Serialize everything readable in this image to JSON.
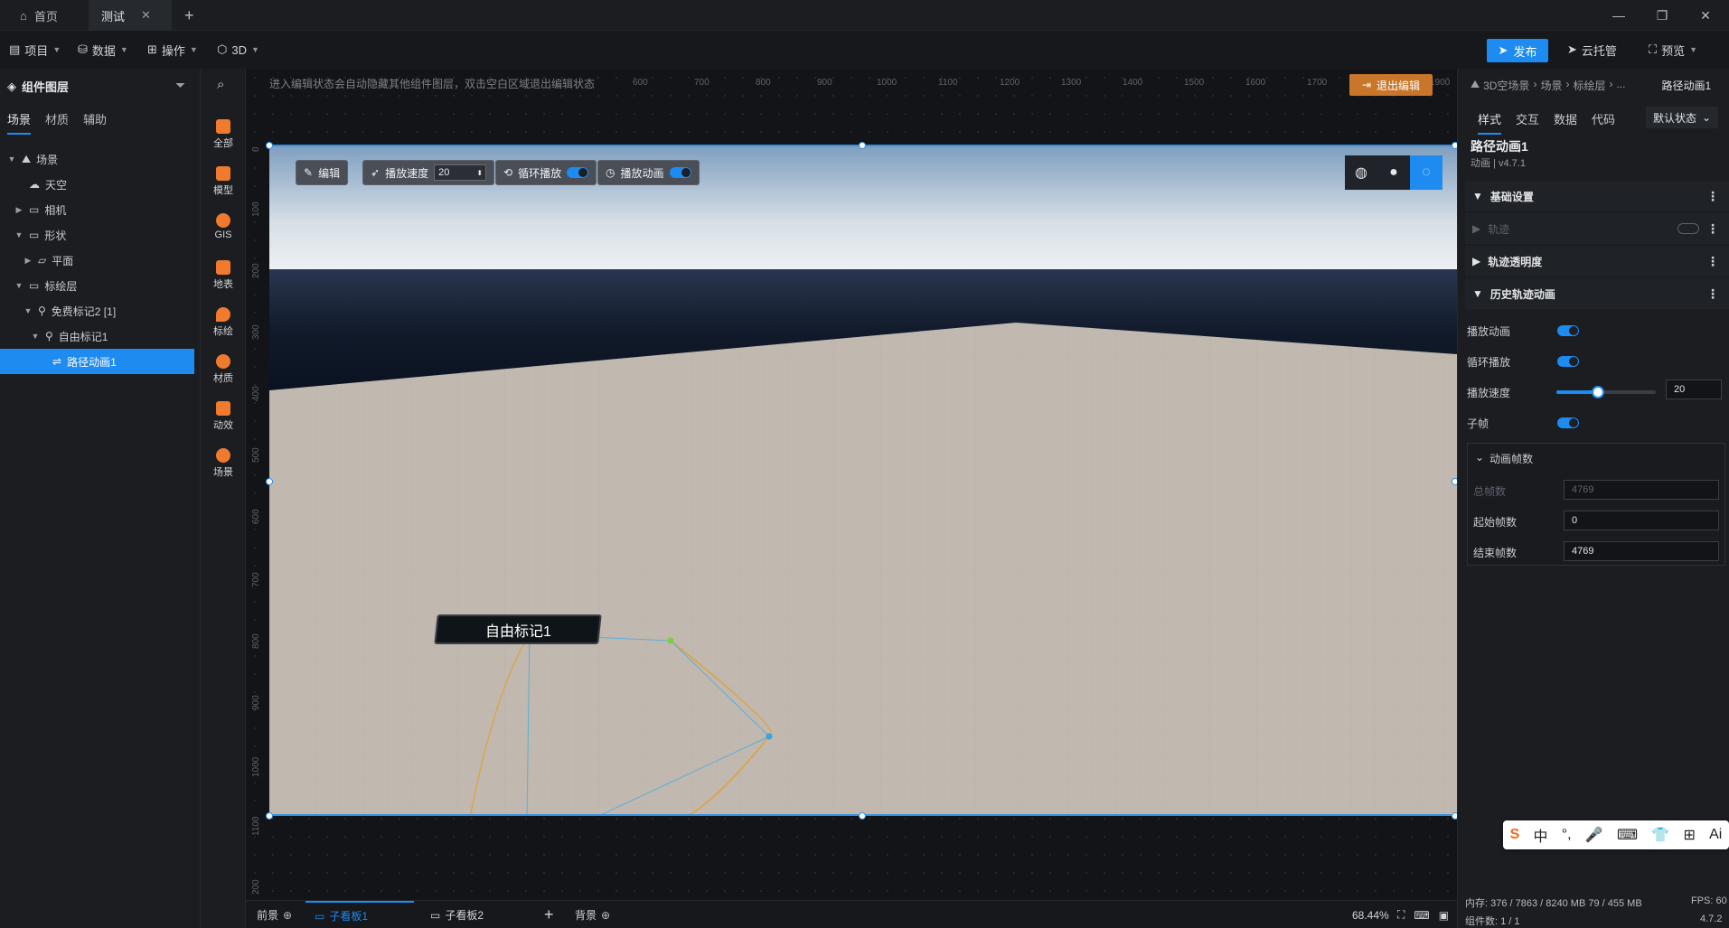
{
  "window": {
    "tabs": [
      {
        "label": "首页",
        "icon": "home-icon"
      },
      {
        "label": "测试",
        "icon": ""
      }
    ],
    "new_tab_glyph": "+",
    "minimize_glyph": "—",
    "restore_glyph": "❐",
    "close_glyph": "✕"
  },
  "menubar": {
    "items": [
      "项目",
      "数据",
      "操作",
      "3D"
    ],
    "publish": "发布",
    "cloud": "云托管",
    "preview": "预览"
  },
  "layers": {
    "title": "组件图层",
    "tabs": [
      "场景",
      "材质",
      "辅助"
    ],
    "tree": [
      {
        "label": "场景"
      },
      {
        "label": "天空"
      },
      {
        "label": "相机"
      },
      {
        "label": "形状"
      },
      {
        "label": "平面"
      },
      {
        "label": "标绘层"
      },
      {
        "label": "免费标记2 [1]"
      },
      {
        "label": "自由标记1"
      },
      {
        "label": "路径动画1"
      }
    ]
  },
  "palette": {
    "items": [
      "全部",
      "模型",
      "GIS",
      "地表",
      "标绘",
      "材质",
      "动效",
      "场景"
    ]
  },
  "canvas": {
    "hint": "进入编辑状态会自动隐藏其他组件图层，双击空白区域退出编辑状态",
    "exit_edit": "退出编辑",
    "ruler_top": [
      "600",
      "700",
      "800",
      "900",
      "1000",
      "1100",
      "1200",
      "1300",
      "1400",
      "1500",
      "1600",
      "1700",
      "1900"
    ],
    "ruler_left": [
      "0",
      "100",
      "200",
      "300",
      "400",
      "500",
      "600",
      "700",
      "800",
      "900",
      "1000",
      "1100",
      "200"
    ],
    "toolbar": {
      "edit": "编辑",
      "speed_label": "播放速度",
      "speed_value": "20",
      "loop_label": "循环播放",
      "play_label": "播放动画"
    },
    "marker_label": "自由标记1"
  },
  "boards": {
    "front": "前景",
    "board1": "子看板1",
    "board2": "子看板2",
    "add": "+",
    "background": "背景",
    "zoom": "68.44%"
  },
  "props": {
    "breadcrumb": [
      "3D空场景",
      "场景",
      "标绘层",
      "..."
    ],
    "current": "路径动画1",
    "tabs": [
      "样式",
      "交互",
      "数据",
      "代码"
    ],
    "state": "默认状态",
    "title": "路径动画1",
    "subtitle": "动画 | v4.7.1",
    "sections": {
      "basic": "基础设置",
      "track": "轨迹",
      "track_opacity": "轨迹透明度",
      "history": "历史轨迹动画",
      "frames": "动画帧数"
    },
    "play": "播放动画",
    "loop": "循环播放",
    "speed": "播放速度",
    "speed_value": "20",
    "speed_fraction": 0.42,
    "subframe": "子帧",
    "total_label": "总帧数",
    "total_value": "4769",
    "start_label": "起始帧数",
    "start_value": "0",
    "end_label": "结束帧数",
    "end_value": "4769"
  },
  "status": {
    "memory": "内存:  376 / 7863 / 8240 MB  79 / 455 MB",
    "fps": "FPS: 60",
    "count": "组件数: 1 / 1",
    "version": "4.7.2"
  },
  "ime": [
    "S",
    "中",
    "°,",
    "🎤",
    "⌨",
    "👕",
    "⊞",
    "Ai"
  ]
}
